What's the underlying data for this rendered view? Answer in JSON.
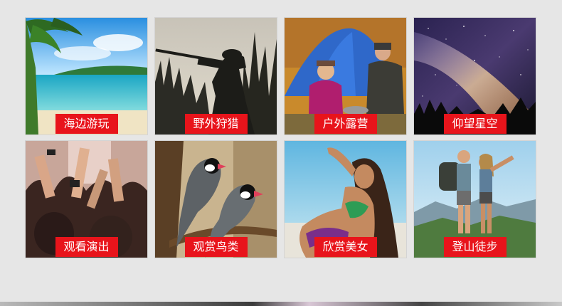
{
  "tiles": [
    {
      "label": "海边游玩",
      "icon": "beach-image"
    },
    {
      "label": "野外狩猎",
      "icon": "hunting-image"
    },
    {
      "label": "户外露营",
      "icon": "camping-image"
    },
    {
      "label": "仰望星空",
      "icon": "stargazing-image"
    },
    {
      "label": "观看演出",
      "icon": "concert-image"
    },
    {
      "label": "观赏鸟类",
      "icon": "birds-image"
    },
    {
      "label": "欣赏美女",
      "icon": "model-image"
    },
    {
      "label": "登山徒步",
      "icon": "hiking-image"
    }
  ],
  "colors": {
    "label_bg": "#e8141b",
    "page_bg": "#e6e6e6"
  }
}
